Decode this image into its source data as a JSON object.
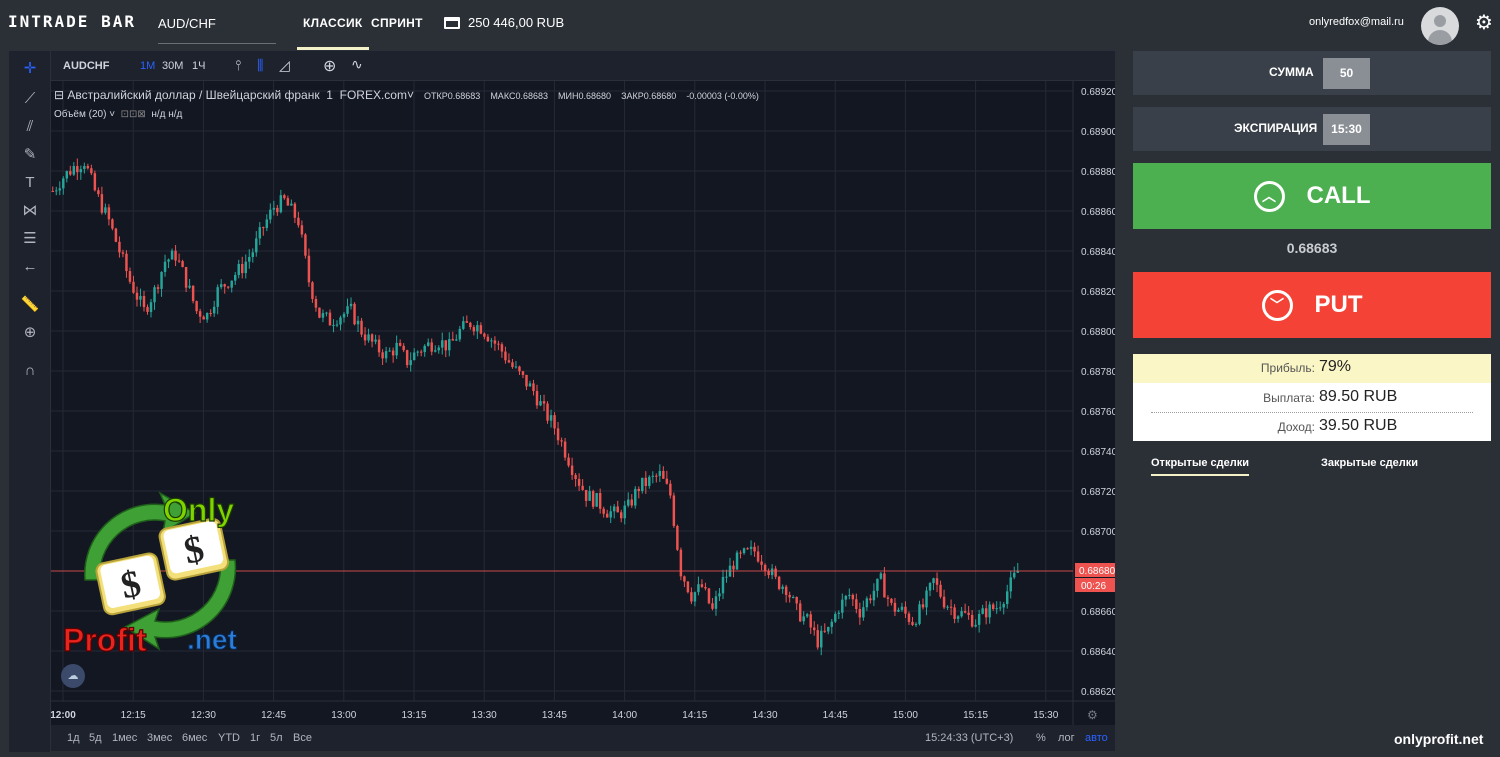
{
  "header": {
    "logo": "INTRADE BAR",
    "pair": "AUD/CHF",
    "tabs": [
      {
        "label": "КЛАССИК",
        "active": true
      },
      {
        "label": "СПРИНТ",
        "active": false
      }
    ],
    "balance": "250 446,00 RUB",
    "email": "onlyredfox@mail.ru"
  },
  "chart_toolbar": {
    "symbol": "AUDCHF",
    "intervals": [
      "1M",
      "30M",
      "1Ч"
    ]
  },
  "chart_legend": {
    "title": "Австралийский доллар / Швейцарский франк",
    "interval": "1",
    "source": "FOREX.com",
    "open_label": "ОТКР",
    "open": "0.68683",
    "high_label": "МАКС",
    "high": "0.68683",
    "low_label": "МИН",
    "low": "0.68680",
    "close_label": "ЗАКР",
    "close": "0.68680",
    "change": "-0.00003 (-0.00%)",
    "volume": "Объём (20)",
    "volume_values": "н/д  н/д"
  },
  "chart_bottom": {
    "ranges": [
      "1д",
      "5д",
      "1мес",
      "3мес",
      "6мес",
      "YTD",
      "1г",
      "5л",
      "Все"
    ],
    "clock": "15:24:33 (UTC+3)",
    "percent": "%",
    "log": "лог",
    "auto": "авто"
  },
  "chart_data": {
    "type": "candlestick",
    "x_ticks": [
      "12:00",
      "12:15",
      "12:30",
      "12:45",
      "13:00",
      "13:15",
      "13:30",
      "13:45",
      "14:00",
      "14:15",
      "14:30",
      "14:45",
      "15:00",
      "15:15",
      "15:30"
    ],
    "y_ticks": [
      "0.68920",
      "0.68900",
      "0.68880",
      "0.68860",
      "0.68840",
      "0.68820",
      "0.68800",
      "0.68780",
      "0.68760",
      "0.68740",
      "0.68720",
      "0.68700",
      "0.68680",
      "0.68660",
      "0.68640",
      "0.68620"
    ],
    "ylim": [
      0.68615,
      0.68925
    ],
    "current_price": "0.68680",
    "countdown": "00:26",
    "path": [
      [
        0,
        0.6887
      ],
      [
        3,
        0.68877
      ],
      [
        6,
        0.68882
      ],
      [
        9,
        0.68885
      ],
      [
        12,
        0.6887
      ],
      [
        16,
        0.68855
      ],
      [
        19,
        0.6884
      ],
      [
        22,
        0.68825
      ],
      [
        26,
        0.6881
      ],
      [
        29,
        0.6882
      ],
      [
        32,
        0.68835
      ],
      [
        35,
        0.68838
      ],
      [
        38,
        0.68825
      ],
      [
        41,
        0.6881
      ],
      [
        44,
        0.68808
      ],
      [
        47,
        0.6882
      ],
      [
        50,
        0.68825
      ],
      [
        54,
        0.68832
      ],
      [
        57,
        0.6884
      ],
      [
        60,
        0.68852
      ],
      [
        63,
        0.68862
      ],
      [
        66,
        0.68865
      ],
      [
        70,
        0.68855
      ],
      [
        73,
        0.68825
      ],
      [
        76,
        0.68808
      ],
      [
        79,
        0.68805
      ],
      [
        82,
        0.68808
      ],
      [
        85,
        0.6881
      ],
      [
        88,
        0.688
      ],
      [
        92,
        0.68792
      ],
      [
        95,
        0.68788
      ],
      [
        98,
        0.68792
      ],
      [
        101,
        0.68785
      ],
      [
        104,
        0.6879
      ],
      [
        107,
        0.68793
      ],
      [
        110,
        0.68795
      ],
      [
        113,
        0.68792
      ],
      [
        116,
        0.688
      ],
      [
        119,
        0.68804
      ],
      [
        122,
        0.68802
      ],
      [
        125,
        0.68796
      ],
      [
        128,
        0.6879
      ],
      [
        131,
        0.68782
      ],
      [
        134,
        0.68776
      ],
      [
        137,
        0.6877
      ],
      [
        140,
        0.6876
      ],
      [
        143,
        0.68752
      ],
      [
        146,
        0.6874
      ],
      [
        149,
        0.68728
      ],
      [
        152,
        0.68718
      ],
      [
        155,
        0.68715
      ],
      [
        158,
        0.6871
      ],
      [
        161,
        0.68708
      ],
      [
        164,
        0.68712
      ],
      [
        167,
        0.68722
      ],
      [
        170,
        0.68725
      ],
      [
        173,
        0.68728
      ],
      [
        176,
        0.68718
      ],
      [
        179,
        0.6868
      ],
      [
        182,
        0.68668
      ],
      [
        185,
        0.68672
      ],
      [
        188,
        0.6866
      ],
      [
        191,
        0.68675
      ],
      [
        194,
        0.68684
      ],
      [
        197,
        0.68688
      ],
      [
        200,
        0.6869
      ],
      [
        203,
        0.68684
      ],
      [
        206,
        0.68675
      ],
      [
        209,
        0.68672
      ],
      [
        212,
        0.6866
      ],
      [
        215,
        0.68655
      ],
      [
        218,
        0.68645
      ],
      [
        221,
        0.6865
      ],
      [
        224,
        0.68662
      ],
      [
        227,
        0.68668
      ],
      [
        230,
        0.6866
      ],
      [
        233,
        0.68668
      ],
      [
        236,
        0.68675
      ],
      [
        239,
        0.68662
      ],
      [
        242,
        0.6866
      ],
      [
        245,
        0.68655
      ],
      [
        248,
        0.68662
      ],
      [
        251,
        0.68675
      ],
      [
        254,
        0.68665
      ],
      [
        257,
        0.6866
      ],
      [
        260,
        0.68658
      ],
      [
        263,
        0.68655
      ],
      [
        266,
        0.6866
      ],
      [
        269,
        0.68662
      ],
      [
        272,
        0.6867
      ],
      [
        275,
        0.6868
      ]
    ]
  },
  "trade": {
    "amount_label": "СУММА",
    "amount": "50",
    "expiry_label": "ЭКСПИРАЦИЯ",
    "expiry": "15:30",
    "call_label": "CALL",
    "put_label": "PUT",
    "price": "0.68683",
    "profit_label": "Прибыль:",
    "profit": "79%",
    "payout_label": "Выплата:",
    "payout": "89.50 RUB",
    "income_label": "Доход:",
    "income": "39.50 RUB",
    "tabs": [
      "Открытые сделки",
      "Закрытые сделки"
    ]
  },
  "watermark": {
    "top": "Only",
    "bottom_left": "Profit",
    "bottom_right": ".net",
    "site": "onlyprofit.net"
  },
  "colors": {
    "up": "#26a69a",
    "down": "#ef5350",
    "call": "#4caf50",
    "put": "#f44336",
    "accent": "#f4f0c8"
  }
}
